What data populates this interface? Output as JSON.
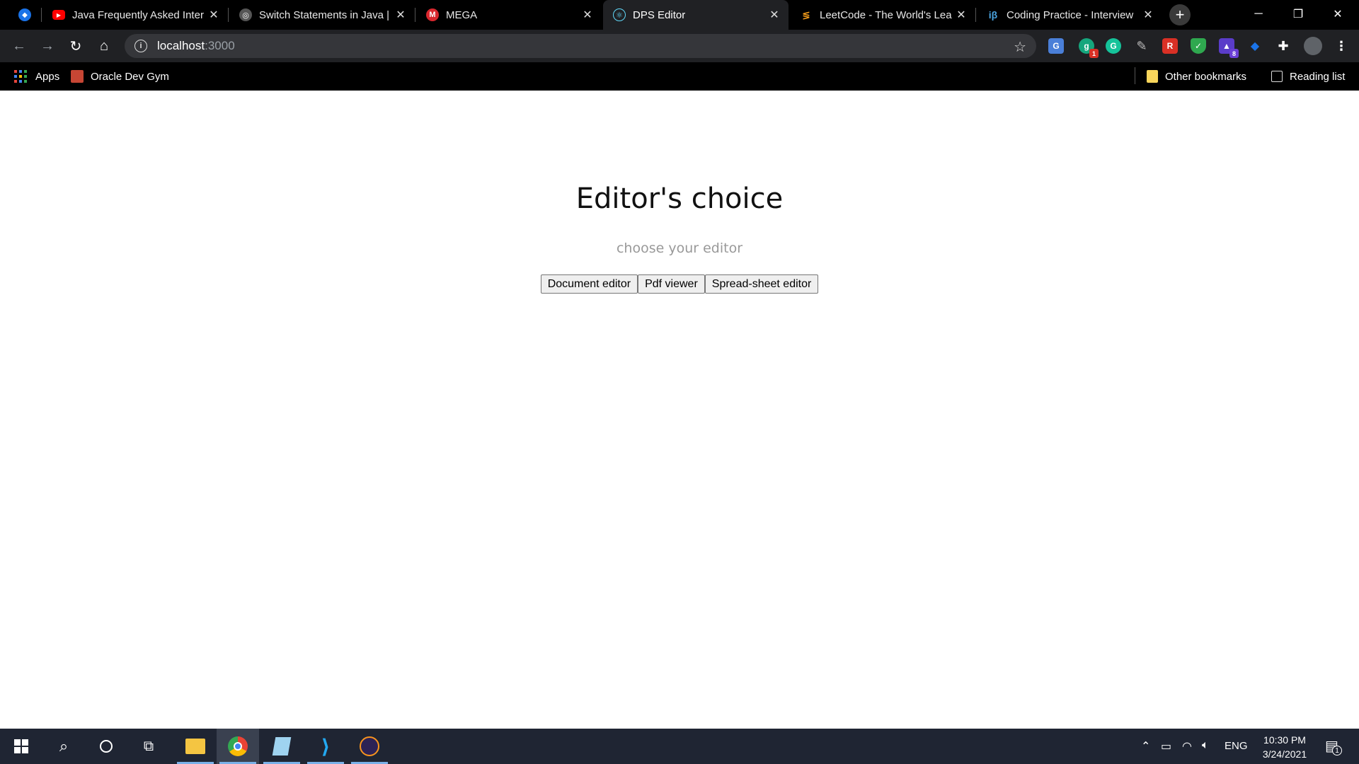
{
  "browser": {
    "tabs": [
      {
        "title": "",
        "favicon": "diamond-icon",
        "color": "#4c8bf5"
      },
      {
        "title": "Java Frequently Asked Inter",
        "favicon": "youtube-icon",
        "color": "#ff0000"
      },
      {
        "title": "Switch Statements in Java | ",
        "favicon": "globe-icon",
        "color": "#888888"
      },
      {
        "title": "MEGA",
        "favicon": "mega-icon",
        "color": "#d9272e"
      },
      {
        "title": "DPS Editor",
        "favicon": "react-icon",
        "color": "#61dafb"
      },
      {
        "title": "LeetCode - The World's Lea",
        "favicon": "leetcode-icon",
        "color": "#f89f1b"
      },
      {
        "title": "Coding Practice - Interview",
        "favicon": "interviewbit-icon",
        "color": "#4aa3df"
      }
    ],
    "address": {
      "host": "localhost",
      "port": ":3000"
    },
    "extensions": [
      {
        "name": "translate-icon",
        "color": "#4a7fd8",
        "label": "G"
      },
      {
        "name": "grammarly-badge-icon",
        "color": "#15a67d",
        "label": "g",
        "badge": "1",
        "badge_color": "#d93025"
      },
      {
        "name": "grammarly-icon",
        "color": "#15c39a",
        "label": "G"
      },
      {
        "name": "pen-icon",
        "color": "#5f6368",
        "label": "/"
      },
      {
        "name": "red-extension-icon",
        "color": "#d93025",
        "label": "R"
      },
      {
        "name": "shield-icon",
        "color": "#2fa84f",
        "label": "✓"
      },
      {
        "name": "graduation-icon",
        "color": "#5a3cc9",
        "label": "▲",
        "badge": "8",
        "badge_color": "#6b3fd6"
      },
      {
        "name": "gem-icon",
        "color": "#1a73e8",
        "label": "◆"
      },
      {
        "name": "puzzle-icon",
        "color": "#202124",
        "label": "✚"
      },
      {
        "name": "profile-icon",
        "color": "#5f6368",
        "label": "●"
      }
    ],
    "bookmarks": {
      "apps": "Apps",
      "oracle": "Oracle Dev Gym",
      "other": "Other bookmarks",
      "reading": "Reading list"
    }
  },
  "page": {
    "heading": "Editor's choice",
    "subtitle": "choose your editor",
    "buttons": [
      "Document editor",
      "Pdf viewer",
      "Spread-sheet editor"
    ]
  },
  "taskbar": {
    "tray_language": "ENG",
    "time": "10:30 PM",
    "date": "3/24/2021",
    "notifications": "1"
  }
}
